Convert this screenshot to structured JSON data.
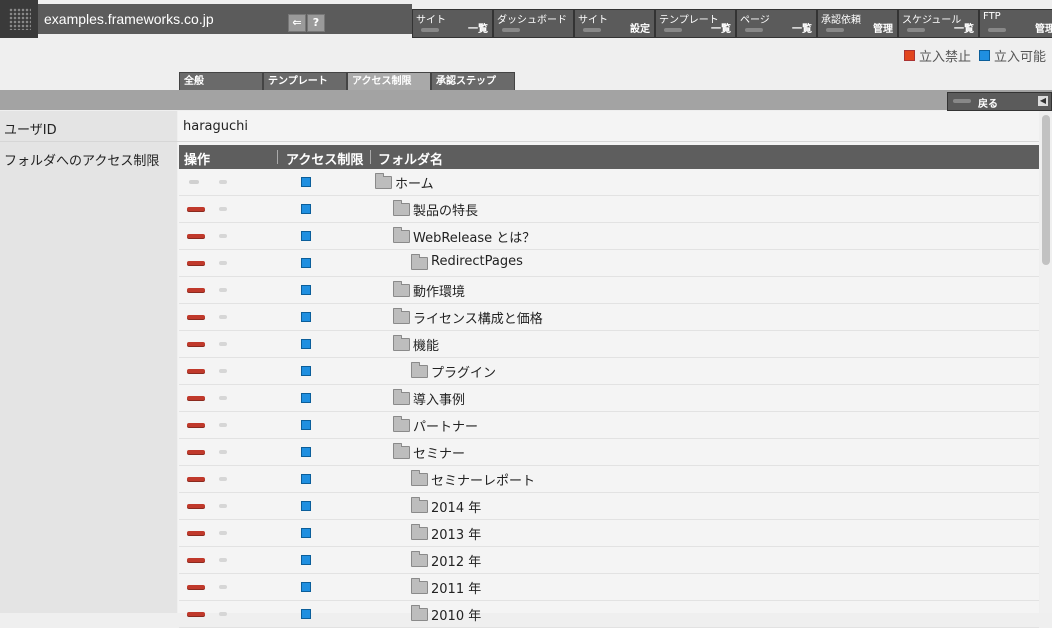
{
  "header": {
    "site_name": "examples.frameworks.co.jp"
  },
  "menu": [
    {
      "top": "サイト",
      "bottom": "一覧"
    },
    {
      "top": "ダッシュボード",
      "bottom": ""
    },
    {
      "top": "サイト",
      "bottom": "設定"
    },
    {
      "top": "テンプレート",
      "bottom": "一覧"
    },
    {
      "top": "ページ",
      "bottom": "一覧"
    },
    {
      "top": "承認依頼",
      "bottom": "管理"
    },
    {
      "top": "スケジュール",
      "bottom": "一覧"
    },
    {
      "top": "FTP",
      "bottom": "管理"
    }
  ],
  "legend": {
    "forbidden": "立入禁止",
    "allowed": "立入可能",
    "forbidden_color": "#e2461e",
    "allowed_color": "#1f8fe0"
  },
  "tabs": [
    "全般",
    "テンプレート",
    "アクセス制限",
    "承認ステップ"
  ],
  "back_label": "戻る",
  "form": {
    "userid_label": "ユーザID",
    "userid_value": "haraguchi",
    "folder_label": "フォルダへのアクセス制限"
  },
  "table": {
    "headers": {
      "op": "操作",
      "access": "アクセス制限",
      "folder": "フォルダ名"
    },
    "rows": [
      {
        "name": "ホーム",
        "level": 0,
        "red": false
      },
      {
        "name": "製品の特長",
        "level": 1,
        "red": true
      },
      {
        "name": "WebRelease とは？",
        "level": 1,
        "red": true
      },
      {
        "name": "RedirectPages",
        "level": 2,
        "red": true
      },
      {
        "name": "動作環境",
        "level": 1,
        "red": true
      },
      {
        "name": "ライセンス構成と価格",
        "level": 1,
        "red": true
      },
      {
        "name": "機能",
        "level": 1,
        "red": true
      },
      {
        "name": "プラグイン",
        "level": 2,
        "red": true
      },
      {
        "name": "導入事例",
        "level": 1,
        "red": true
      },
      {
        "name": "パートナー",
        "level": 1,
        "red": true
      },
      {
        "name": "セミナー",
        "level": 1,
        "red": true
      },
      {
        "name": "セミナーレポート",
        "level": 2,
        "red": true
      },
      {
        "name": "2014 年",
        "level": 2,
        "red": true
      },
      {
        "name": "2013 年",
        "level": 2,
        "red": true
      },
      {
        "name": "2012 年",
        "level": 2,
        "red": true
      },
      {
        "name": "2011 年",
        "level": 2,
        "red": true
      },
      {
        "name": "2010 年",
        "level": 2,
        "red": true
      }
    ]
  }
}
